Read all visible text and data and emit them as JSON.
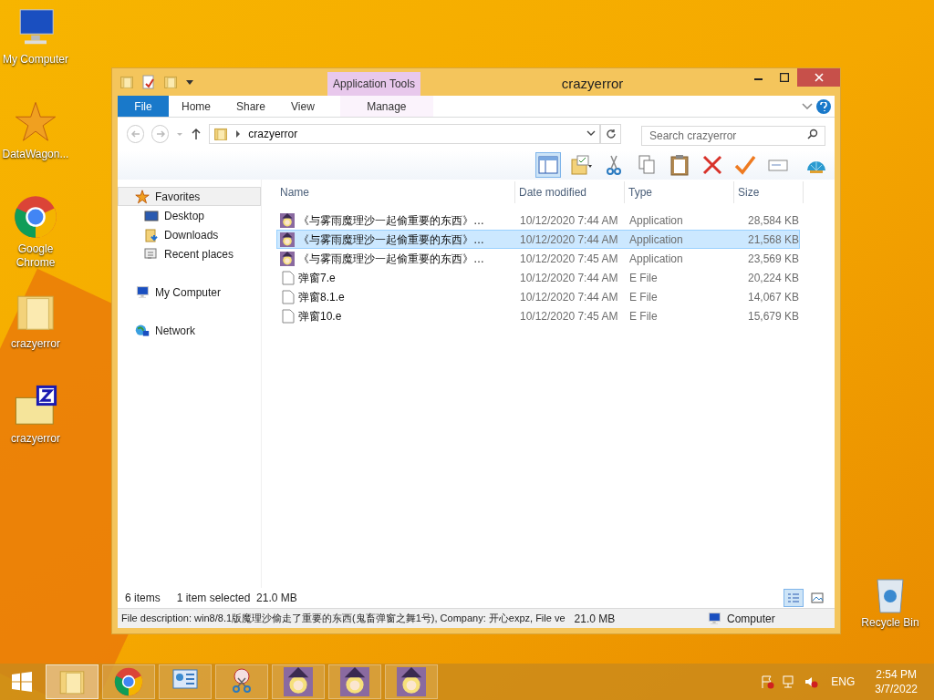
{
  "desktop_icons": [
    {
      "label": "My Computer",
      "kind": "computer"
    },
    {
      "label": "DataWagon...",
      "kind": "star"
    },
    {
      "label": "Google Chrome",
      "kind": "chrome"
    },
    {
      "label": "crazyerror",
      "kind": "folder"
    },
    {
      "label": "crazyerror",
      "kind": "zip"
    }
  ],
  "window": {
    "title": "crazyerror",
    "context_tab": "Application Tools",
    "ribbon_tabs": [
      {
        "label": "File",
        "kind": "file"
      },
      {
        "label": "Home",
        "kind": "tab"
      },
      {
        "label": "Share",
        "kind": "tab"
      },
      {
        "label": "View",
        "kind": "tab"
      },
      {
        "label": "Manage",
        "kind": "context"
      }
    ],
    "address": "crazyerror",
    "search": {
      "placeholder": "Search crazyerror"
    },
    "nav": [
      {
        "label": "Favorites",
        "selected": true,
        "children": [
          {
            "label": "Desktop",
            "selected": false
          },
          {
            "label": "Downloads",
            "selected": false
          },
          {
            "label": "Recent places",
            "selected": false
          }
        ]
      },
      {
        "label": "My Computer",
        "selected": false
      },
      {
        "label": "Network",
        "selected": false
      }
    ],
    "columns": [
      "Name",
      "Date modified",
      "Type",
      "Size"
    ],
    "rows": [
      {
        "name": "《与雾雨魔理沙一起偷重要的东西》…",
        "date": "10/12/2020 7:44 AM",
        "type": "Application",
        "size": "28,584 KB",
        "kind": "app",
        "selected": false
      },
      {
        "name": "《与雾雨魔理沙一起偷重要的东西》…",
        "date": "10/12/2020 7:44 AM",
        "type": "Application",
        "size": "21,568 KB",
        "kind": "app",
        "selected": true
      },
      {
        "name": "《与雾雨魔理沙一起偷重要的东西》…",
        "date": "10/12/2020 7:45 AM",
        "type": "Application",
        "size": "23,569 KB",
        "kind": "app",
        "selected": false
      },
      {
        "name": "弹窗7.e",
        "date": "10/12/2020 7:44 AM",
        "type": "E File",
        "size": "20,224 KB",
        "kind": "file",
        "selected": false
      },
      {
        "name": "弹窗8.1.e",
        "date": "10/12/2020 7:44 AM",
        "type": "E File",
        "size": "14,067 KB",
        "kind": "file",
        "selected": false
      },
      {
        "name": "弹窗10.e",
        "date": "10/12/2020 7:45 AM",
        "type": "E File",
        "size": "15,679 KB",
        "kind": "file",
        "selected": false
      }
    ],
    "status": {
      "count": "6 items",
      "selection": "1 item selected  21.0 MB"
    },
    "details": {
      "description": "File description: win8/8.1版魔理沙偷走了重要的东西(鬼畜弹窗之舞1号), Company: 开心expz, File ve",
      "size": "21.0 MB",
      "zone": "Computer"
    }
  },
  "recycle_bin": {
    "label": "Recycle Bin"
  },
  "taskbar": {
    "buttons": [
      {
        "kind": "explorer",
        "selected": true
      },
      {
        "kind": "chrome",
        "selected": false
      },
      {
        "kind": "control",
        "selected": false
      },
      {
        "kind": "paint",
        "selected": false
      },
      {
        "kind": "app",
        "selected": false
      },
      {
        "kind": "app",
        "selected": false
      },
      {
        "kind": "app",
        "selected": false
      }
    ],
    "language": "ENG",
    "time": "2:54 PM",
    "date": "3/7/2022"
  }
}
